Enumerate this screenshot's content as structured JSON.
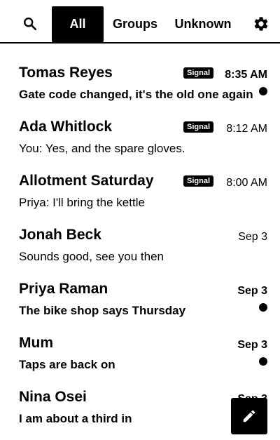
{
  "toolbar": {
    "tabs": [
      {
        "label": "All",
        "selected": true
      },
      {
        "label": "Groups",
        "selected": false
      },
      {
        "label": "Unknown",
        "selected": false
      }
    ],
    "icons": {
      "search": "search-icon",
      "settings": "gear-icon"
    }
  },
  "conversations": [
    {
      "name": "Tomas Reyes",
      "preview": "Gate code changed, it's the old one again",
      "time": "8:35 AM",
      "badge": "Signal",
      "unread": true
    },
    {
      "name": "Ada Whitlock",
      "preview": "You: Yes, and the spare gloves.",
      "time": "8:12 AM",
      "badge": "Signal",
      "unread": false
    },
    {
      "name": "Allotment Saturday",
      "preview": "Priya: I'll bring the kettle",
      "time": "8:00 AM",
      "badge": "Signal",
      "unread": false
    },
    {
      "name": "Jonah Beck",
      "preview": "Sounds good, see you then",
      "time": "Sep 3",
      "badge": "",
      "unread": false
    },
    {
      "name": "Priya Raman",
      "preview": "The bike shop says Thursday",
      "time": "Sep 3",
      "badge": "",
      "unread": true
    },
    {
      "name": "Mum",
      "preview": "Taps are back on",
      "time": "Sep 3",
      "badge": "",
      "unread": true
    },
    {
      "name": "Nina Osei",
      "preview": "I am about a third in",
      "time": "Sep 3",
      "badge": "",
      "unread": true
    }
  ],
  "fab": {
    "icon": "pencil-icon"
  },
  "colors": {
    "accent": "#000000",
    "background": "#ffffff"
  }
}
